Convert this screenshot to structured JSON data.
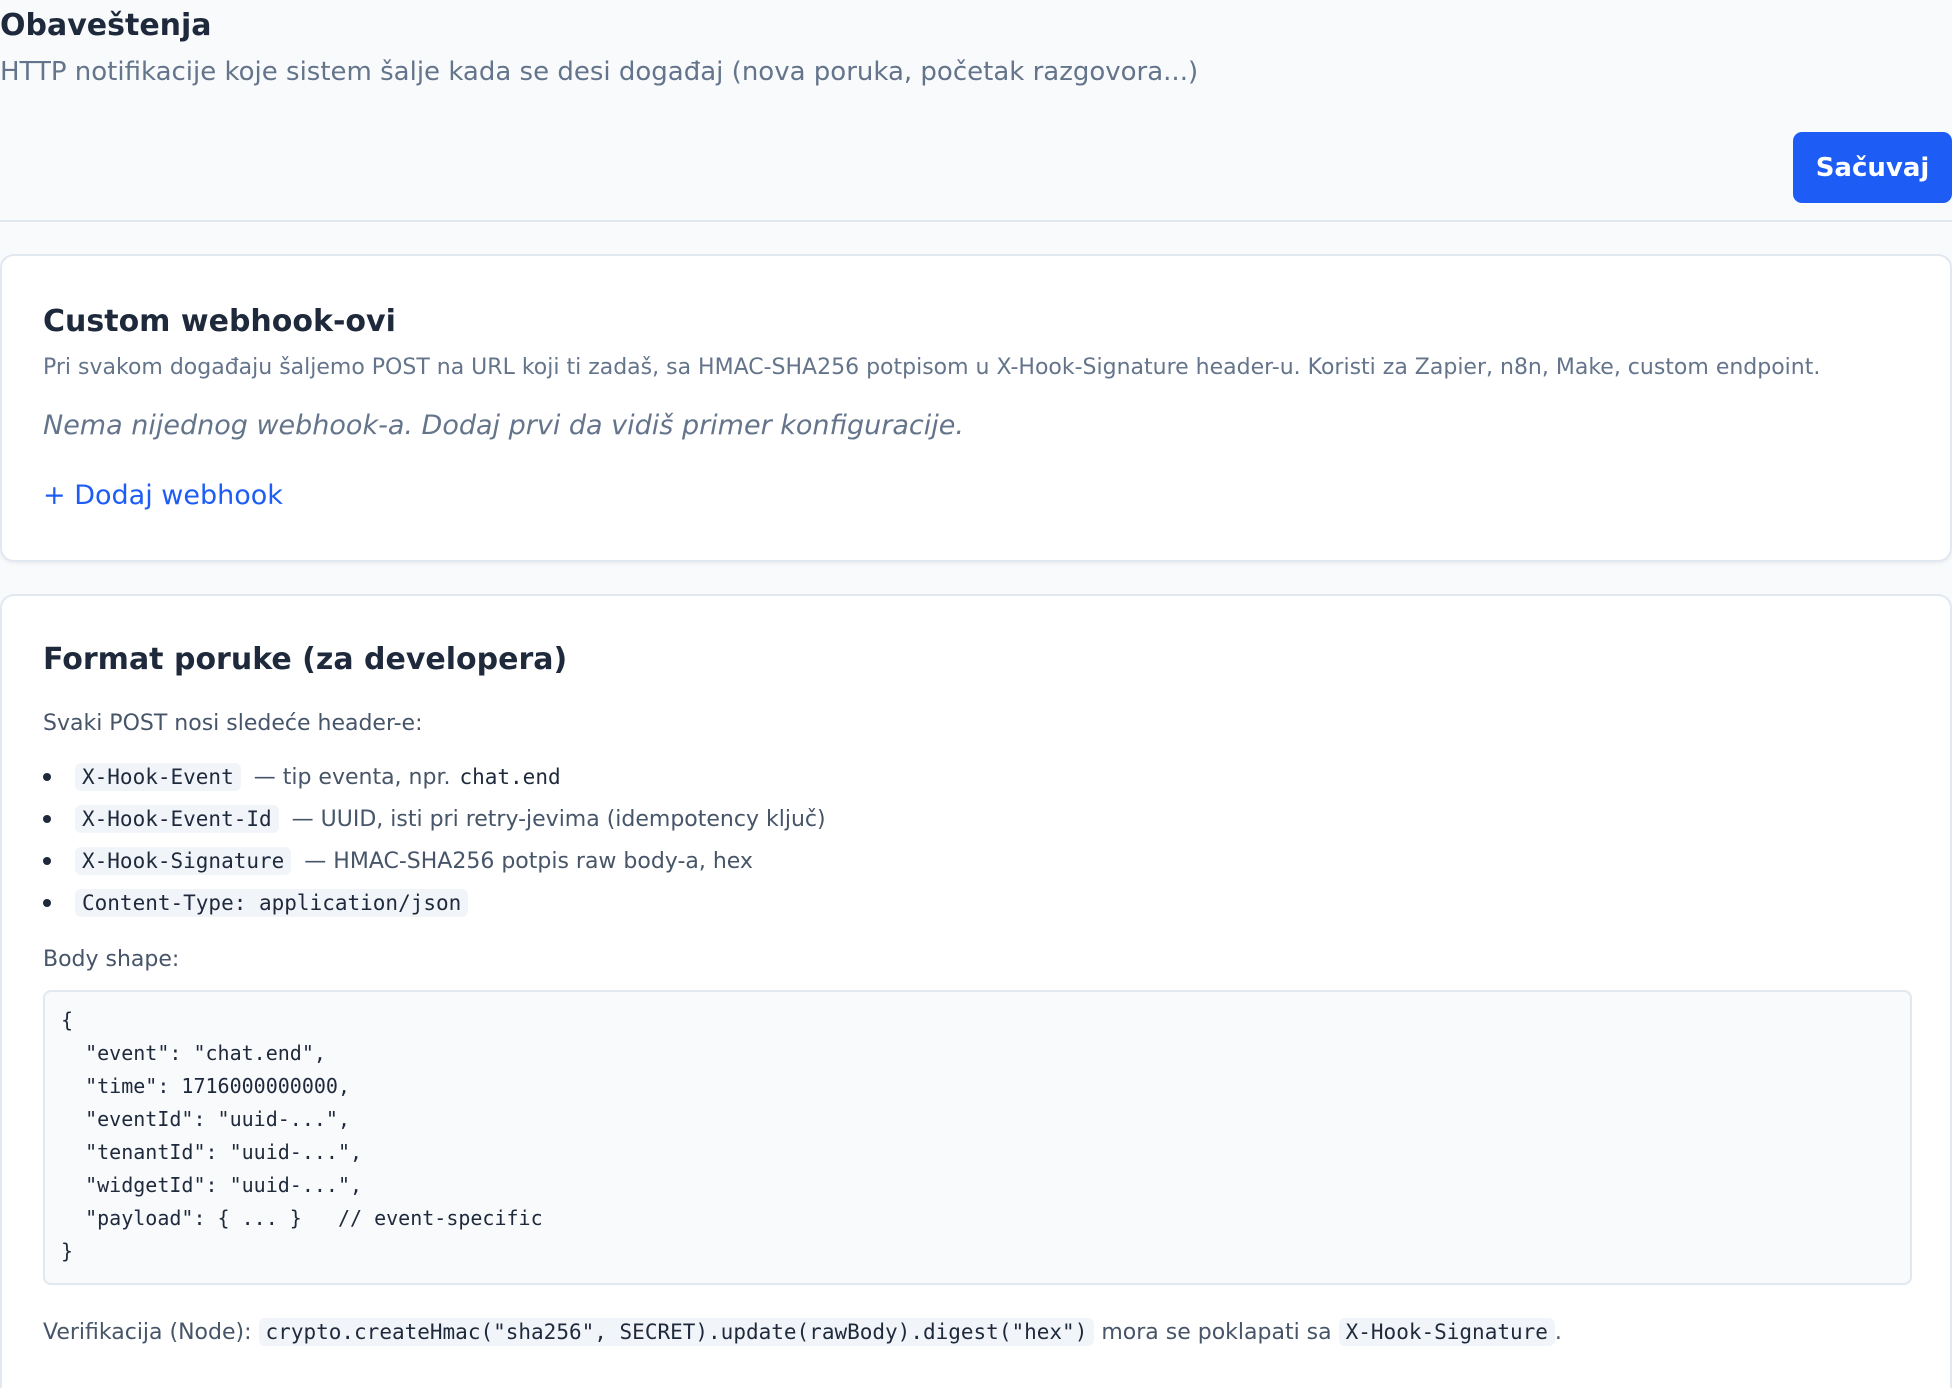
{
  "header": {
    "title": "Obaveštenja",
    "subtitle": "HTTP notifikacije koje sistem šalje kada se desi događaj (nova poruka, početak razgovora...)",
    "save_label": "Sačuvaj"
  },
  "webhooks": {
    "title": "Custom webhook-ovi",
    "description": "Pri svakom događaju šaljemo POST na URL koji ti zadaš, sa HMAC-SHA256 potpisom u X-Hook-Signature header-u. Koristi za Zapier, n8n, Make, custom endpoint.",
    "empty_note": "Nema nijednog webhook-a. Dodaj prvi da vidiš primer konfiguracije.",
    "add_label": "+ Dodaj webhook"
  },
  "format": {
    "title": "Format poruke (za developera)",
    "headers_intro": "Svaki POST nosi sledeće header-e:",
    "headers": [
      {
        "code": "X-Hook-Event",
        "text": "— tip eventa, npr.",
        "example": "chat.end"
      },
      {
        "code": "X-Hook-Event-Id",
        "text": "— UUID, isti pri retry-jevima (idempotency ključ)",
        "example": ""
      },
      {
        "code": "X-Hook-Signature",
        "text": "— HMAC-SHA256 potpis raw body-a, hex",
        "example": ""
      },
      {
        "code": "Content-Type: application/json",
        "text": "",
        "example": ""
      }
    ],
    "body_label": "Body shape:",
    "body_code": "{\n  \"event\": \"chat.end\",\n  \"time\": 1716000000000,\n  \"eventId\": \"uuid-...\",\n  \"tenantId\": \"uuid-...\",\n  \"widgetId\": \"uuid-...\",\n  \"payload\": { ... }   // event-specific\n}",
    "verify_prefix": "Verifikacija (Node):",
    "verify_code": "crypto.createHmac(\"sha256\", SECRET).update(rawBody).digest(\"hex\")",
    "verify_middle": "mora se poklapati sa",
    "verify_header": "X-Hook-Signature",
    "verify_suffix": "."
  }
}
